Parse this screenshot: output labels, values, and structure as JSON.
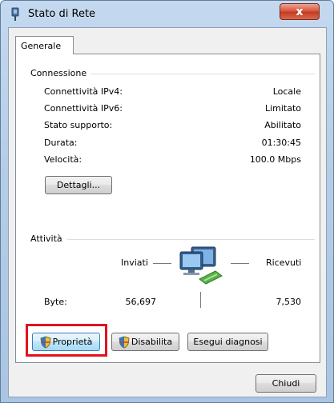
{
  "window": {
    "title": "Stato di Rete",
    "close_label": "x"
  },
  "tabs": [
    {
      "label": "Generale"
    }
  ],
  "connection": {
    "heading": "Connessione",
    "rows": [
      {
        "label": "Connettività IPv4:",
        "value": "Locale"
      },
      {
        "label": "Connettività IPv6:",
        "value": "Limitato"
      },
      {
        "label": "Stato supporto:",
        "value": "Abilitato"
      },
      {
        "label": "Durata:",
        "value": "01:30:45"
      },
      {
        "label": "Velocità:",
        "value": "100.0 Mbps"
      }
    ],
    "details_button": "Dettagli..."
  },
  "activity": {
    "heading": "Attività",
    "sent_label": "Inviati",
    "received_label": "Ricevuti",
    "bytes_label": "Byte:",
    "bytes_sent": "56,697",
    "bytes_received": "7,530",
    "icon": "network-computers-icon"
  },
  "buttons": {
    "properties": "Proprietà",
    "disable": "Disabilita",
    "diagnose": "Esegui diagnosi",
    "close": "Chiudi"
  },
  "colors": {
    "highlight": "#e0141e",
    "window_frame": "#b6cde6",
    "close_button": "#c33a1f"
  }
}
